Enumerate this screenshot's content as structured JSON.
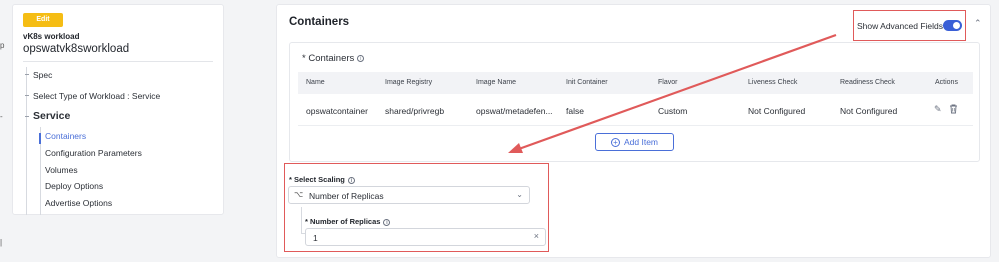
{
  "left_panel": {
    "edit_label": "Edit",
    "workload_type": "vK8s workload",
    "workload_name": "opswatvk8sworkload",
    "nav": {
      "spec": "Spec",
      "select_type": "Select Type of Workload : Service",
      "service": "Service",
      "containers": "Containers",
      "config_params": "Configuration Parameters",
      "volumes": "Volumes",
      "deploy_options": "Deploy Options",
      "advertise_options": "Advertise Options"
    }
  },
  "main": {
    "title": "Containers",
    "show_advanced_label": "Show Advanced Fields",
    "show_advanced_on": true,
    "containers_card": {
      "title": "* Containers",
      "columns": [
        "Name",
        "Image Registry",
        "Image Name",
        "Init Container",
        "Flavor",
        "Liveness Check",
        "Readiness Check",
        "Actions"
      ],
      "rows": [
        {
          "name": "opswatcontainer",
          "image_registry": "shared/privregb",
          "image_name": "opswat/metadefen...",
          "init_container": "false",
          "flavor": "Custom",
          "liveness": "Not Configured",
          "readiness": "Not Configured"
        }
      ],
      "add_item_label": "Add Item"
    },
    "scaling": {
      "label": "* Select Scaling",
      "selected": "Number of Replicas",
      "replicas_label": "* Number of Replicas",
      "replicas_value": "1"
    }
  },
  "colors": {
    "accent": "#4a6fd8",
    "edit_badge": "#f5bd14",
    "highlight": "#e05a5a"
  }
}
